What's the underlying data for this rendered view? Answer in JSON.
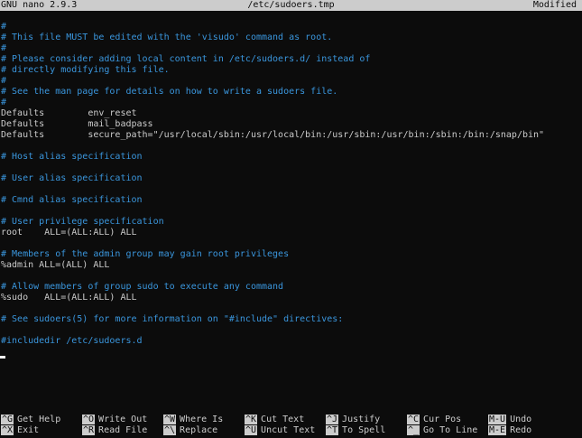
{
  "titlebar": {
    "app": "GNU nano 2.9.3",
    "filename": "/etc/sudoers.tmp",
    "status": "Modified"
  },
  "file_lines": [
    {
      "text": "#",
      "type": "comment"
    },
    {
      "text": "# This file MUST be edited with the 'visudo' command as root.",
      "type": "comment"
    },
    {
      "text": "#",
      "type": "comment"
    },
    {
      "text": "# Please consider adding local content in /etc/sudoers.d/ instead of",
      "type": "comment"
    },
    {
      "text": "# directly modifying this file.",
      "type": "comment"
    },
    {
      "text": "#",
      "type": "comment"
    },
    {
      "text": "# See the man page for details on how to write a sudoers file.",
      "type": "comment"
    },
    {
      "text": "#",
      "type": "comment"
    },
    {
      "text": "Defaults        env_reset",
      "type": "normal"
    },
    {
      "text": "Defaults        mail_badpass",
      "type": "normal"
    },
    {
      "text": "Defaults        secure_path=\"/usr/local/sbin:/usr/local/bin:/usr/sbin:/usr/bin:/sbin:/bin:/snap/bin\"",
      "type": "normal"
    },
    {
      "text": "",
      "type": "normal"
    },
    {
      "text": "# Host alias specification",
      "type": "comment"
    },
    {
      "text": "",
      "type": "normal"
    },
    {
      "text": "# User alias specification",
      "type": "comment"
    },
    {
      "text": "",
      "type": "normal"
    },
    {
      "text": "# Cmnd alias specification",
      "type": "comment"
    },
    {
      "text": "",
      "type": "normal"
    },
    {
      "text": "# User privilege specification",
      "type": "comment"
    },
    {
      "text": "root    ALL=(ALL:ALL) ALL",
      "type": "normal"
    },
    {
      "text": "",
      "type": "normal"
    },
    {
      "text": "# Members of the admin group may gain root privileges",
      "type": "comment"
    },
    {
      "text": "%admin ALL=(ALL) ALL",
      "type": "normal"
    },
    {
      "text": "",
      "type": "normal"
    },
    {
      "text": "# Allow members of group sudo to execute any command",
      "type": "comment"
    },
    {
      "text": "%sudo   ALL=(ALL:ALL) ALL",
      "type": "normal"
    },
    {
      "text": "",
      "type": "normal"
    },
    {
      "text": "# See sudoers(5) for more information on \"#include\" directives:",
      "type": "comment"
    },
    {
      "text": "",
      "type": "normal"
    },
    {
      "text": "#includedir /etc/sudoers.d",
      "type": "comment"
    }
  ],
  "shortcuts": {
    "row1": [
      {
        "key": "^G",
        "label": "Get Help"
      },
      {
        "key": "^O",
        "label": "Write Out"
      },
      {
        "key": "^W",
        "label": "Where Is"
      },
      {
        "key": "^K",
        "label": "Cut Text"
      },
      {
        "key": "^J",
        "label": "Justify"
      },
      {
        "key": "^C",
        "label": "Cur Pos"
      },
      {
        "key": "M-U",
        "label": "Undo"
      }
    ],
    "row2": [
      {
        "key": "^X",
        "label": "Exit"
      },
      {
        "key": "^R",
        "label": "Read File"
      },
      {
        "key": "^\\",
        "label": "Replace"
      },
      {
        "key": "^U",
        "label": "Uncut Text"
      },
      {
        "key": "^T",
        "label": "To Spell"
      },
      {
        "key": "^_",
        "label": "Go To Line"
      },
      {
        "key": "M-E",
        "label": "Redo"
      }
    ]
  },
  "colors": {
    "background": "#0c0c0c",
    "foreground": "#cccccc",
    "comment": "#3a96dd",
    "titlebar_bg": "#cccccc"
  }
}
